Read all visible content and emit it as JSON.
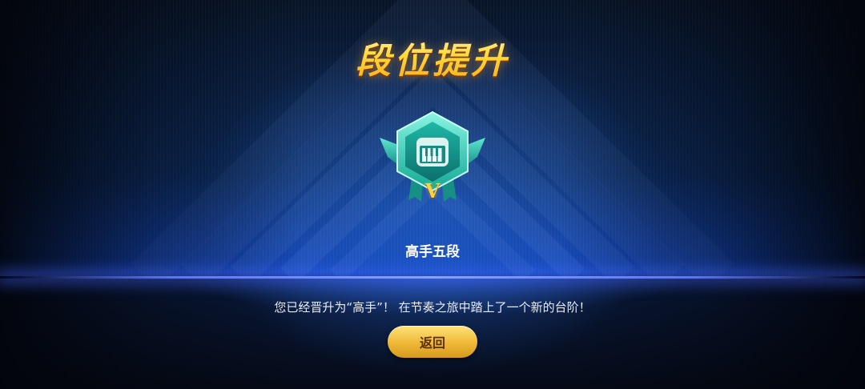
{
  "popup": {
    "title": "段位提升",
    "rank_name": "高手五段",
    "badge_numeral": "V",
    "message": "您已经晋升为“高手”！ 在节奏之旅中踏上了一个新的台阶！",
    "back_label": "返回"
  },
  "colors": {
    "title_gold": "#ffd93a",
    "badge_teal": "#33d6c0",
    "button_gold": "#f0bb3a",
    "floor_blue": "#5a74ff"
  },
  "icons": {
    "badge": "piano-rank-badge-icon"
  }
}
